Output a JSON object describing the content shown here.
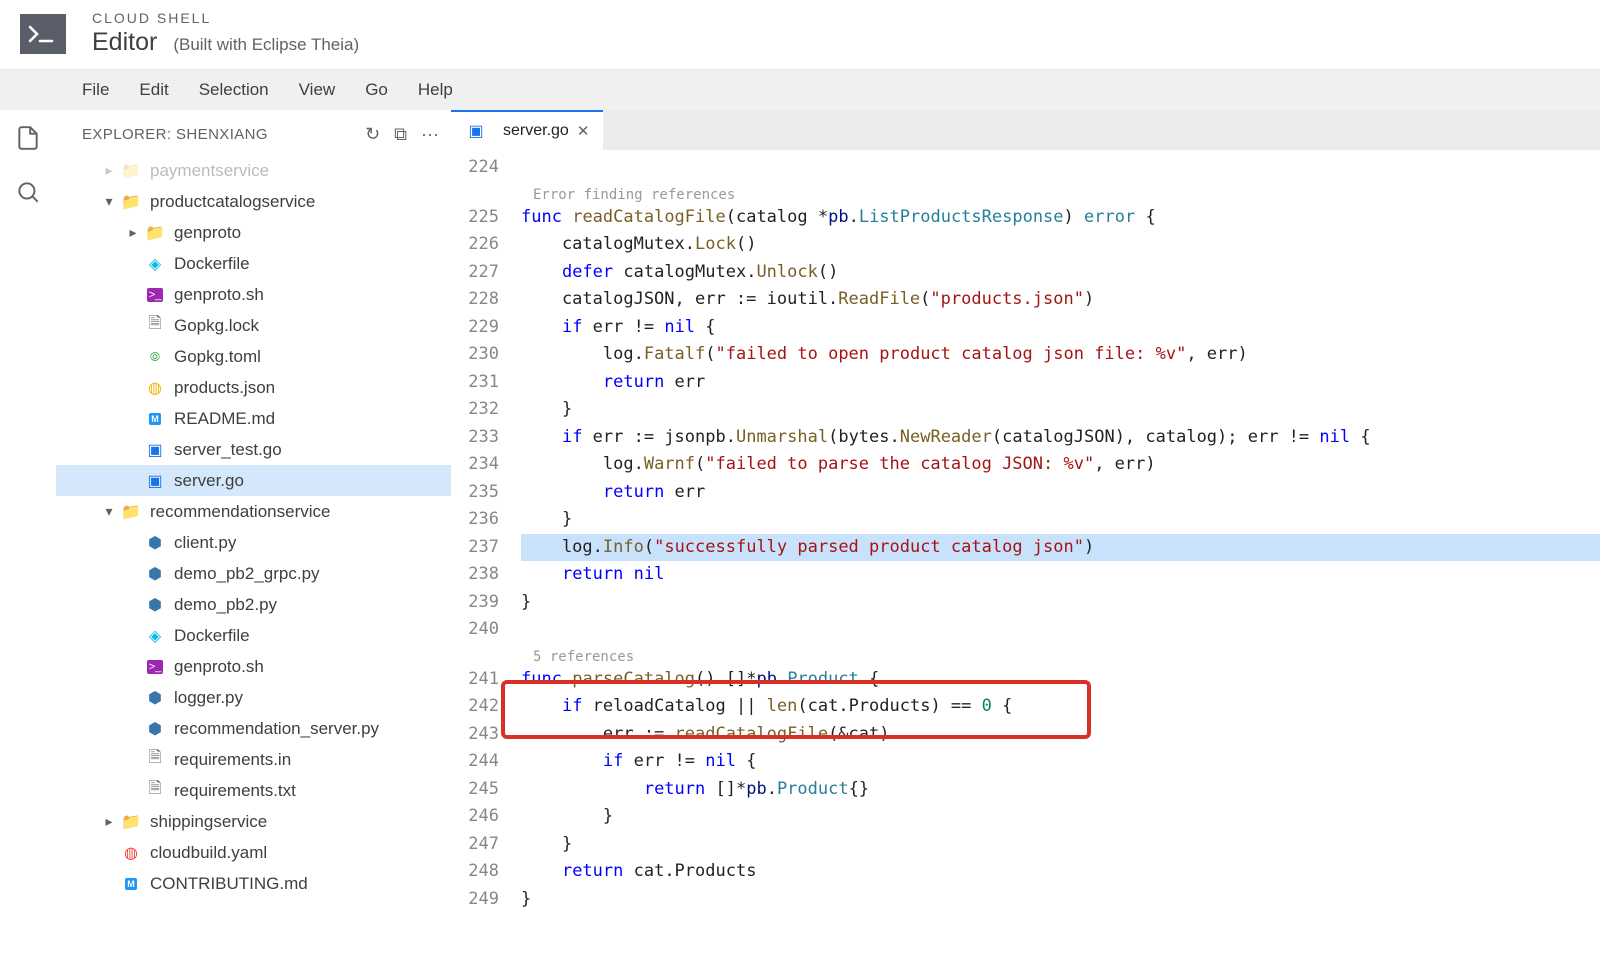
{
  "header": {
    "overline": "CLOUD SHELL",
    "title": "Editor",
    "subtitle": "(Built with Eclipse Theia)"
  },
  "menubar": {
    "items": [
      "File",
      "Edit",
      "Selection",
      "View",
      "Go",
      "Help"
    ]
  },
  "sidebar": {
    "title": "EXPLORER: SHENXIANG",
    "actions": {
      "refresh": "↻",
      "collapse": "⧉",
      "more": "···"
    }
  },
  "tree": {
    "paymentservice": "paymentservice",
    "productcatalogservice": "productcatalogservice",
    "genproto": "genproto",
    "dockerfile": "Dockerfile",
    "genproto_sh": "genproto.sh",
    "gopkg_lock": "Gopkg.lock",
    "gopkg_toml": "Gopkg.toml",
    "products_json": "products.json",
    "readme_md": "README.md",
    "server_test": "server_test.go",
    "server_go": "server.go",
    "recommendationservice": "recommendationservice",
    "client_py": "client.py",
    "demo_grpc": "demo_pb2_grpc.py",
    "demo_pb2": "demo_pb2.py",
    "dockerfile2": "Dockerfile",
    "genproto_sh2": "genproto.sh",
    "logger_py": "logger.py",
    "rec_server": "recommendation_server.py",
    "req_in": "requirements.in",
    "req_txt": "requirements.txt",
    "shipping": "shippingservice",
    "cloudbuild": "cloudbuild.yaml",
    "contributing": "CONTRIBUTING.md"
  },
  "tab": {
    "label": "server.go",
    "close": "✕"
  },
  "codelens": {
    "err_ref": "Error finding references",
    "five_ref": "5 references"
  },
  "lines": {
    "l224": "224",
    "l225": "225",
    "l226": "226",
    "l227": "227",
    "l228": "228",
    "l229": "229",
    "l230": "230",
    "l231": "231",
    "l232": "232",
    "l233": "233",
    "l234": "234",
    "l235": "235",
    "l236": "236",
    "l237": "237",
    "l238": "238",
    "l239": "239",
    "l240": "240",
    "l241": "241",
    "l242": "242",
    "l243": "243",
    "l244": "244",
    "l245": "245",
    "l246": "246",
    "l247": "247",
    "l248": "248",
    "l249": "249"
  },
  "code": {
    "l225_func": "func",
    "l225_name": "readCatalogFile",
    "l225_param": "(catalog *",
    "l225_pb": "pb",
    "l225_dot": ".",
    "l225_type": "ListProductsResponse",
    "l225_paren": ") ",
    "l225_error": "error",
    "l225_brace": " {",
    "l226": "    catalogMutex.",
    "l226_lock": "Lock",
    "l226_p": "()",
    "l227_defer": "defer",
    "l227_rest": " catalogMutex.",
    "l227_unlock": "Unlock",
    "l227_p": "()",
    "l228_a": "    catalogJSON, err := ioutil.",
    "l228_rf": "ReadFile",
    "l228_p1": "(",
    "l228_str": "\"products.json\"",
    "l228_p2": ")",
    "l229_if": "if",
    "l229_rest": " err != ",
    "l229_nil": "nil",
    "l229_brace": " {",
    "l230_a": "        log.",
    "l230_fatalf": "Fatalf",
    "l230_p1": "(",
    "l230_str": "\"failed to open product catalog json file: %v\"",
    "l230_rest": ", err)",
    "l231_ret": "return",
    "l231_err": " err",
    "l232_brace": "    }",
    "l233_if": "if",
    "l233_a": " err := jsonpb.",
    "l233_unm": "Unmarshal",
    "l233_b": "(bytes.",
    "l233_nr": "NewReader",
    "l233_c": "(catalogJSON), catalog); err != ",
    "l233_nil": "nil",
    "l233_brace": " {",
    "l234_a": "        log.",
    "l234_warnf": "Warnf",
    "l234_p1": "(",
    "l234_str": "\"failed to parse the catalog JSON: %v\"",
    "l234_rest": ", err)",
    "l235_ret": "return",
    "l235_err": " err",
    "l236_brace": "    }",
    "l237_a": "    log.",
    "l237_info": "Info",
    "l237_p1": "(",
    "l237_str": "\"successfully parsed product catalog json\"",
    "l237_p2": ")",
    "l238_ret": "return",
    "l238_nil": "nil",
    "l239_brace": "}",
    "l241_func": "func",
    "l241_name": "parseCatalog",
    "l241_sig": "() []*",
    "l241_pb": "pb",
    "l241_dot": ".",
    "l241_prod": "Product",
    "l241_brace": " {",
    "l242_if": "if",
    "l242_a": " reloadCatalog || ",
    "l242_len": "len",
    "l242_b": "(cat.Products) == ",
    "l242_zero": "0",
    "l242_brace": " {",
    "l243_a": "        err := ",
    "l243_fn": "readCatalogFile",
    "l243_b": "(&cat)",
    "l244_if": "if",
    "l244_a": " err != ",
    "l244_nil": "nil",
    "l244_brace": " {",
    "l245_ret": "return",
    "l245_a": " []*",
    "l245_pb": "pb",
    "l245_dot": ".",
    "l245_prod": "Product",
    "l245_b": "{}",
    "l246_brace": "        }",
    "l247_brace": "    }",
    "l248_ret": "return",
    "l248_a": " cat.Products",
    "l249_brace": "}"
  }
}
